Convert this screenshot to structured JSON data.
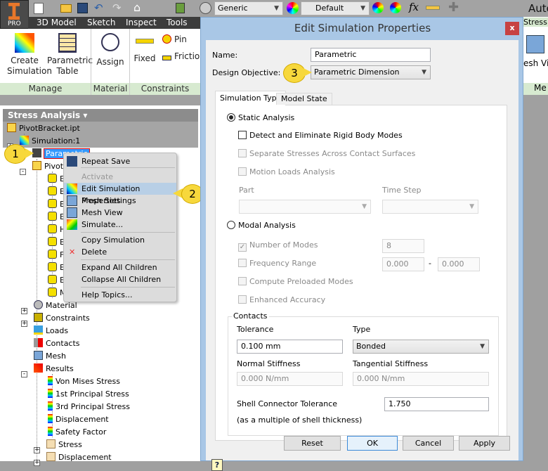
{
  "app": {
    "logo_badge": "PRO",
    "title_partial": "Auto"
  },
  "quick_access": {
    "material_value": "Generic",
    "appearance_value": "Default"
  },
  "menu_tabs": [
    "3D Model",
    "Sketch",
    "Inspect",
    "Tools"
  ],
  "ribbon": {
    "buttons": [
      {
        "label": "Create Simulation"
      },
      {
        "label": "Parametric Table"
      },
      {
        "label": "Assign"
      },
      {
        "label": "Fixed"
      },
      {
        "label": "Pin"
      },
      {
        "label": "Frictio"
      }
    ],
    "groups": [
      "Manage",
      "Material",
      "Constraints"
    ],
    "right_tab": "Stress A",
    "right_button": "esh Vie",
    "right_group": "Me"
  },
  "browser": {
    "title": "Stress Analysis ▾",
    "items": [
      "PivotBracket.ipt",
      "Simulation:1",
      "Parametric",
      "PivotBracket.ipt",
      "E",
      "E",
      "E",
      "E",
      "H",
      "E",
      "F",
      "E",
      "E",
      "M",
      "Material",
      "Constraints",
      "Loads",
      "Contacts",
      "Mesh",
      "Results",
      "Von Mises Stress",
      "1st Principal Stress",
      "3rd Principal Stress",
      "Displacement",
      "Safety Factor",
      "Stress",
      "Displacement"
    ]
  },
  "context_menu": {
    "items": [
      {
        "label": "Repeat Save",
        "state": "normal"
      },
      {
        "label": "Activate",
        "state": "disabled"
      },
      {
        "label": "Edit Simulation Properties",
        "state": "highlighted"
      },
      {
        "label": "Mesh Settings",
        "state": "normal"
      },
      {
        "label": "Mesh View",
        "state": "normal"
      },
      {
        "label": "Simulate...",
        "state": "normal"
      },
      {
        "label": "Copy Simulation",
        "state": "normal"
      },
      {
        "label": "Delete",
        "state": "normal"
      },
      {
        "label": "Expand All Children",
        "state": "normal"
      },
      {
        "label": "Collapse All Children",
        "state": "normal"
      },
      {
        "label": "Help Topics...",
        "state": "normal"
      }
    ]
  },
  "callouts": [
    "1",
    "2",
    "3"
  ],
  "dialog": {
    "title": "Edit Simulation Properties",
    "close": "x",
    "name_label": "Name:",
    "name_value": "Parametric",
    "objective_label": "Design Objective:",
    "objective_value": "Parametric Dimension",
    "tabs": [
      "Simulation Type",
      "Model State"
    ],
    "static_analysis": "Static Analysis",
    "detect_rigid": "Detect and Eliminate Rigid Body Modes",
    "separate_stresses": "Separate Stresses Across Contact Surfaces",
    "motion_loads": "Motion Loads Analysis",
    "part_label": "Part",
    "time_step_label": "Time Step",
    "modal_analysis": "Modal Analysis",
    "number_of_modes": "Number of Modes",
    "number_of_modes_value": "8",
    "frequency_range": "Frequency Range",
    "freq_min": "0.000",
    "freq_dash": "-",
    "freq_max": "0.000",
    "compute_preloaded": "Compute Preloaded Modes",
    "enhanced_accuracy": "Enhanced Accuracy",
    "contacts": {
      "legend": "Contacts",
      "tolerance_label": "Tolerance",
      "tolerance_value": "0.100 mm",
      "type_label": "Type",
      "type_value": "Bonded",
      "normal_label": "Normal Stiffness",
      "normal_value": "0.000 N/mm",
      "tangential_label": "Tangential Stiffness",
      "tangential_value": "0.000 N/mm",
      "shell_label": "Shell Connector Tolerance",
      "shell_value": "1.750",
      "shell_note": "(as a multiple of shell thickness)"
    },
    "help": "?",
    "buttons": [
      "Reset",
      "OK",
      "Cancel",
      "Apply"
    ]
  },
  "colors": {
    "accent_green": "#8dc26b",
    "dialog_frame": "#a9c7e6",
    "close_red": "#c74242",
    "callout": "#f7d83c",
    "highlight": "#b8cfe6"
  }
}
